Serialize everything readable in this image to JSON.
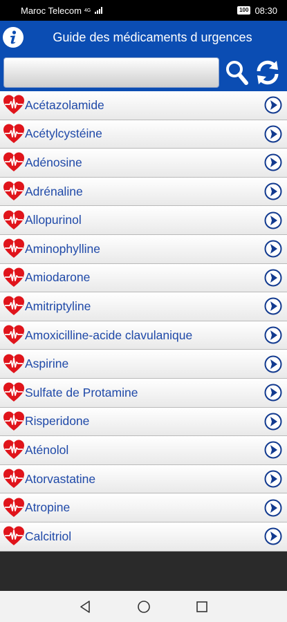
{
  "status_bar": {
    "carrier": "Maroc Telecom",
    "network": "4G",
    "battery": "100",
    "time": "08:30"
  },
  "header": {
    "info_icon": "info-icon",
    "title": "Guide des médicaments d urgences"
  },
  "search": {
    "value": "",
    "placeholder": "",
    "search_icon": "magnifier-icon",
    "refresh_icon": "refresh-icon"
  },
  "drugs": [
    {
      "name": "Acétazolamide"
    },
    {
      "name": "Acétylcystéine"
    },
    {
      "name": "Adénosine"
    },
    {
      "name": "Adrénaline"
    },
    {
      "name": "Allopurinol"
    },
    {
      "name": "Aminophylline"
    },
    {
      "name": "Amiodarone"
    },
    {
      "name": "Amitriptyline"
    },
    {
      "name": "Amoxicilline-acide clavulanique"
    },
    {
      "name": "Aspirine"
    },
    {
      "name": "Sulfate de Protamine"
    },
    {
      "name": "Risperidone"
    },
    {
      "name": "Aténolol"
    },
    {
      "name": "Atorvastatine"
    },
    {
      "name": "Atropine"
    },
    {
      "name": "Calcitriol"
    }
  ],
  "colors": {
    "header_blue": "#0b4db3",
    "drug_text": "#1f49a8",
    "heart_red": "#e0141b",
    "arrow_ring": "#123a8f"
  },
  "nav": {
    "back_icon": "back-triangle-icon",
    "home_icon": "home-circle-icon",
    "recents_icon": "recents-square-icon"
  }
}
